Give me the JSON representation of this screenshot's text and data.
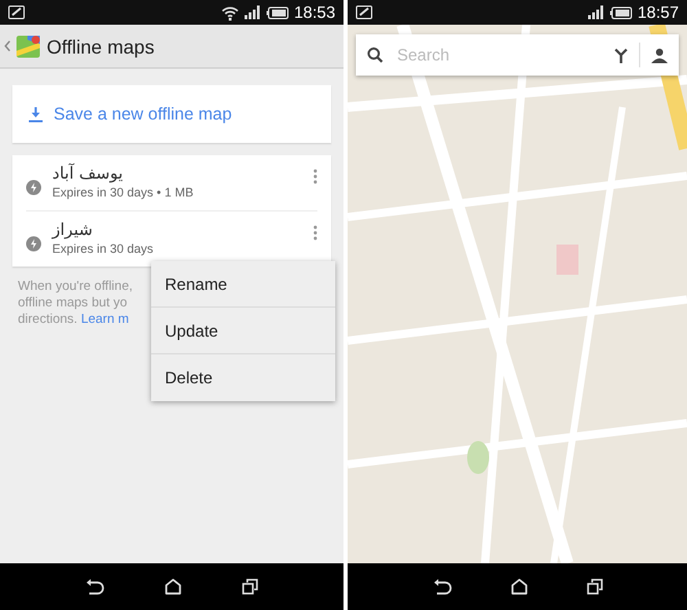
{
  "left_screen": {
    "status_bar": {
      "time": "18:53"
    },
    "app_bar": {
      "title": "Offline maps"
    },
    "save_action": {
      "label": "Save a new offline map"
    },
    "maps": [
      {
        "name": "یوسف آباد",
        "details": "Expires in 30 days • 1 MB"
      },
      {
        "name": "شیراز",
        "details": "Expires in 30 days"
      }
    ],
    "help_text": {
      "lines": [
        "When you're offline,",
        "offline maps but yo",
        "directions. "
      ],
      "link": "Learn m"
    },
    "context_menu": {
      "items": [
        "Rename",
        "Update",
        "Delete"
      ]
    }
  },
  "right_screen": {
    "status_bar": {
      "time": "18:57"
    },
    "search": {
      "placeholder": "Search"
    }
  }
}
